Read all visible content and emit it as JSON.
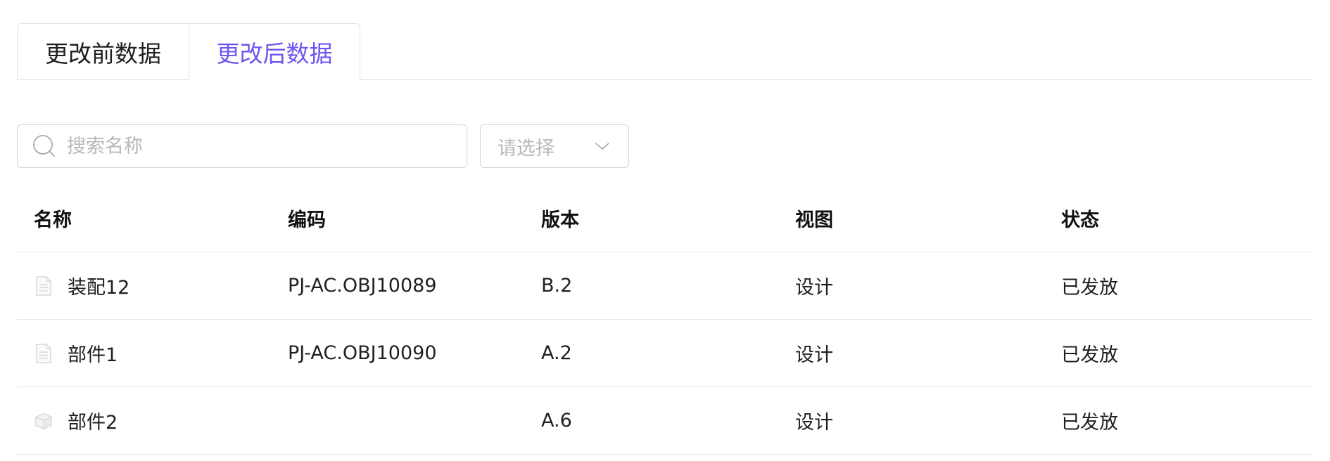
{
  "tabs": [
    {
      "label": "更改前数据",
      "active": false
    },
    {
      "label": "更改后数据",
      "active": true
    }
  ],
  "accent_color": "#6e56f0",
  "search": {
    "placeholder": "搜索名称",
    "value": "",
    "icon": "search-icon"
  },
  "select": {
    "placeholder": "请选择",
    "icon": "chevron-down-icon"
  },
  "table": {
    "columns": [
      "名称",
      "编码",
      "版本",
      "视图",
      "状态"
    ],
    "rows": [
      {
        "icon": "document-icon",
        "name": "装配12",
        "code": "PJ-AC.OBJ10089",
        "version": "B.2",
        "view": "设计",
        "status": "已发放"
      },
      {
        "icon": "document-icon",
        "name": "部件1",
        "code": "PJ-AC.OBJ10090",
        "version": "A.2",
        "view": "设计",
        "status": "已发放"
      },
      {
        "icon": "cube-icon",
        "name": "部件2",
        "code": "",
        "version": "A.6",
        "view": "设计",
        "status": "已发放"
      }
    ]
  }
}
